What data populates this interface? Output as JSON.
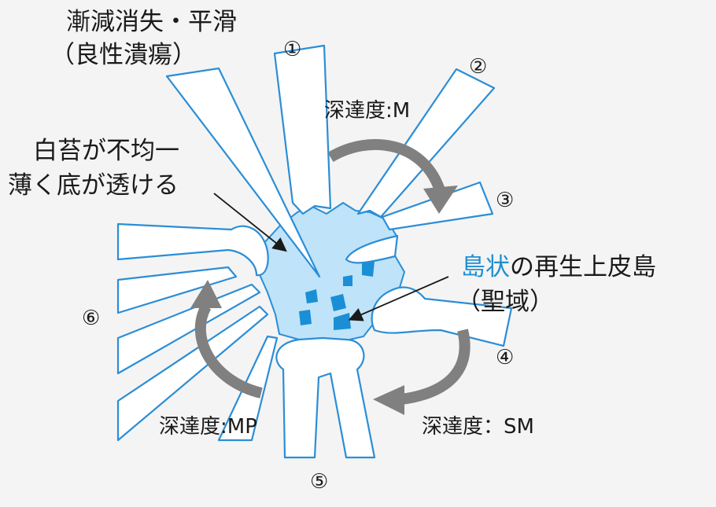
{
  "colors": {
    "background": "#f4f4f4",
    "fold": "#ffffff",
    "fold_outline": "#2b8ed6",
    "ulcer": "#bfe3f8",
    "islands": "#1a8fd6",
    "arrow": "#808080",
    "accent_text": "#1e8fd2"
  },
  "labels": {
    "fold_tapering": {
      "line1": "漸減消失・平滑",
      "line2": "（良性潰瘍）"
    },
    "white_coat": {
      "line1": "白苔が不均一",
      "line2": "薄く底が透ける"
    },
    "island": {
      "highlight": "島状",
      "rest": "の再生上皮島",
      "line2": "（聖域）"
    },
    "depth_m": "深達度:M",
    "depth_sm": "深達度：SM",
    "depth_mp": "深達度:MP"
  },
  "fold_numbers": [
    "①",
    "②",
    "③",
    "④",
    "⑤",
    "⑥"
  ],
  "icons": [
    "curved-arrow-icon",
    "pointer-arrow-icon"
  ]
}
